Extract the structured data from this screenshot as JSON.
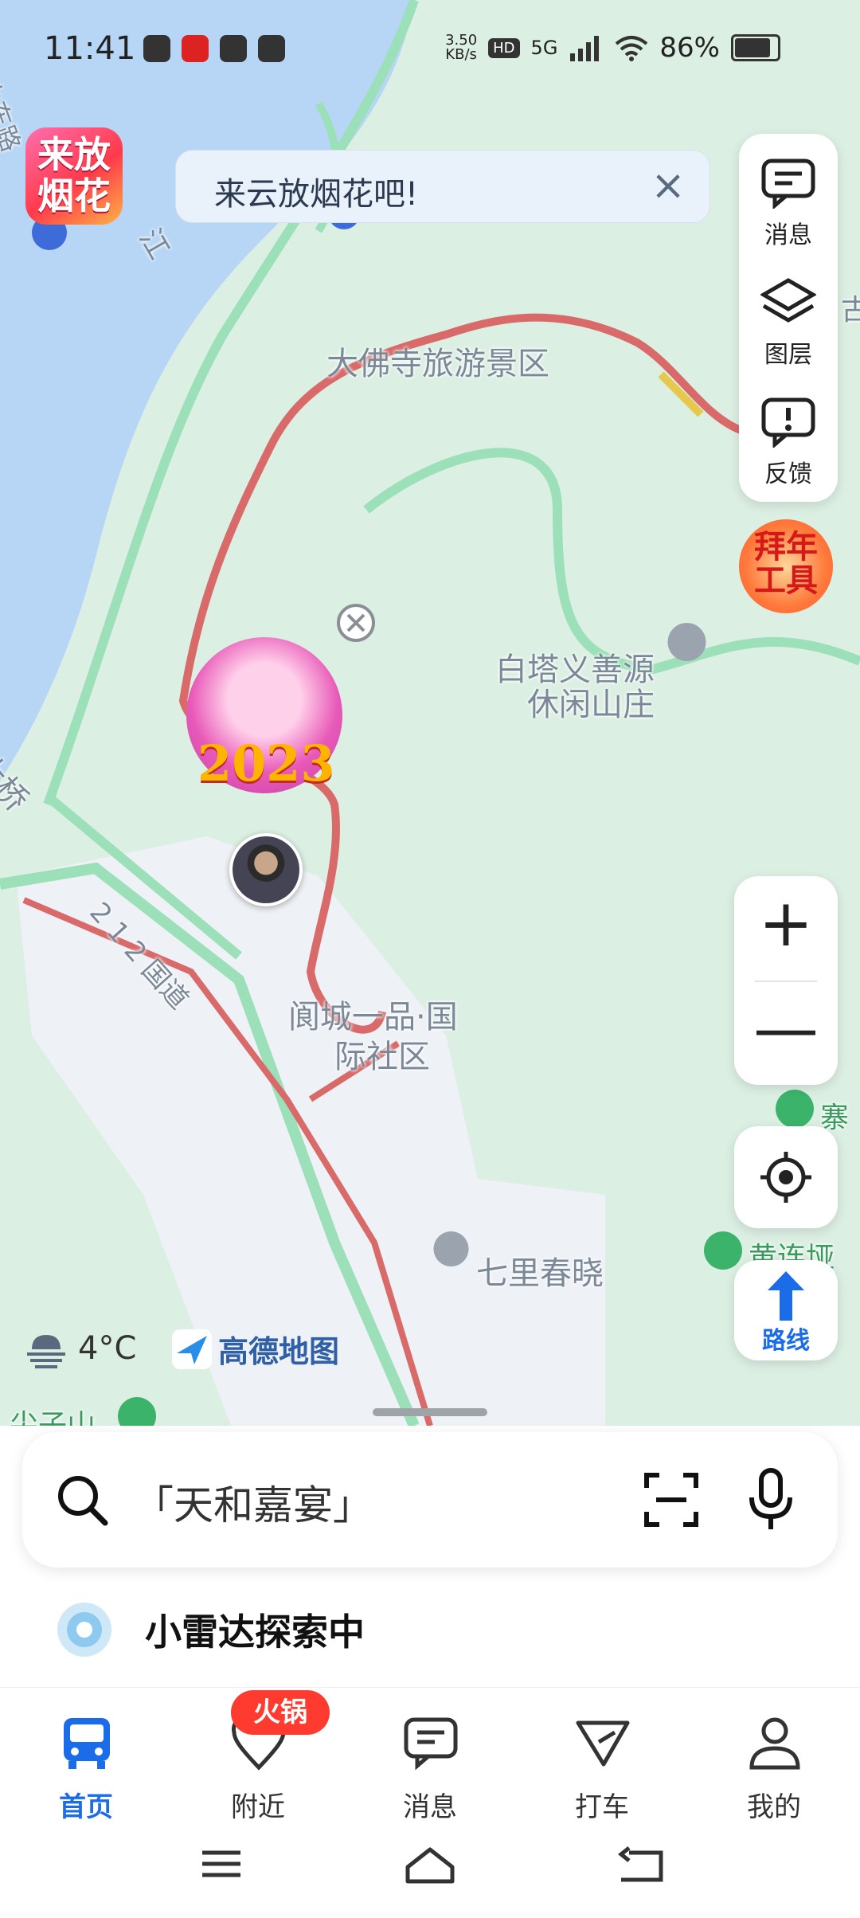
{
  "status_bar": {
    "time": "11:41",
    "net_speed": "3.50\nKB/s",
    "net_speed_value": "3.50",
    "net_speed_unit": "KB/s",
    "hd": "HD",
    "network": "5G",
    "battery": "86%"
  },
  "promo": {
    "label": "来放烟花"
  },
  "banner": {
    "text": "来云放烟花吧!",
    "close_icon": "×"
  },
  "toolbar": {
    "items": [
      {
        "label": "消息",
        "icon": "message-icon"
      },
      {
        "label": "图层",
        "icon": "layers-icon"
      },
      {
        "label": "反馈",
        "icon": "feedback-icon"
      }
    ]
  },
  "nianhuo": {
    "label": "拜年工具"
  },
  "map": {
    "labels": {
      "scenic": "大佛寺旅游景区",
      "resort_line1": "白塔义善源",
      "resort_line2": "休闲山庄",
      "community_line1": "阆城一品·国",
      "community_line2": "际社区",
      "qilichunxiao": "七里春晓",
      "road": "2 1 2 国道",
      "bridge": "大桥",
      "river": "江",
      "east_road": "水东路",
      "jianzishan": "尖子山",
      "zhai": "寨",
      "huanglianya": "黄连垭",
      "gu": "古"
    },
    "pin_year": "2023"
  },
  "zoom": {
    "in": "+",
    "out": "—"
  },
  "route": {
    "label": "路线"
  },
  "weather": {
    "temp": "4°C"
  },
  "brand": {
    "name": "高德地图"
  },
  "search": {
    "placeholder": "「天和嘉宴」"
  },
  "radar": {
    "label": "小雷达探索中"
  },
  "tabs": [
    {
      "label": "首页",
      "active": true
    },
    {
      "label": "附近",
      "badge": "火锅"
    },
    {
      "label": "消息"
    },
    {
      "label": "打车"
    },
    {
      "label": "我的"
    }
  ],
  "colors": {
    "accent": "#1a6ce8",
    "badge": "#ff3b30",
    "river": "#b7d6f5",
    "land": "#dcefe3"
  }
}
